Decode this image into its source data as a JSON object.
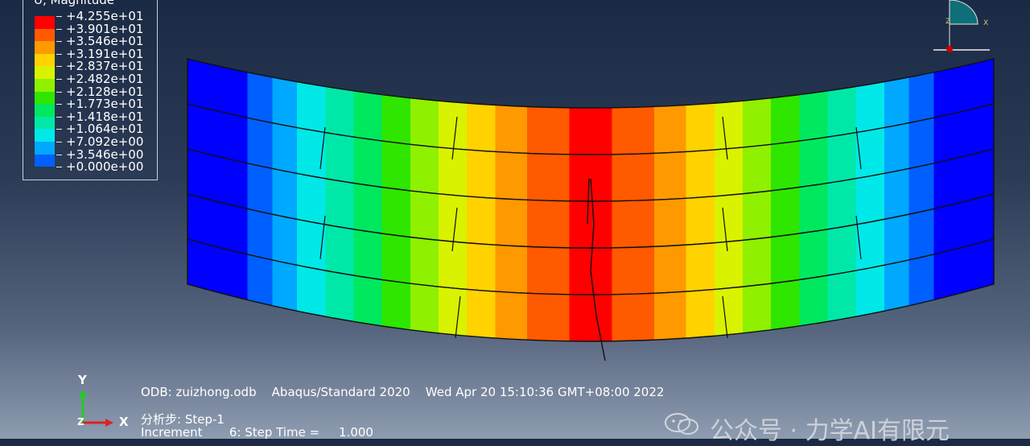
{
  "legend": {
    "title": "U, Magnitude",
    "labels": [
      "+4.255e+01",
      "+3.901e+01",
      "+3.546e+01",
      "+3.191e+01",
      "+2.837e+01",
      "+2.482e+01",
      "+2.128e+01",
      "+1.773e+01",
      "+1.418e+01",
      "+1.064e+01",
      "+7.092e+00",
      "+3.546e+00",
      "+0.000e+00"
    ],
    "colors": [
      "#ff0000",
      "#ff5a00",
      "#ff9900",
      "#ffd200",
      "#d9f200",
      "#8ff000",
      "#2ee600",
      "#00e85e",
      "#00e8a8",
      "#00e8e8",
      "#00a8ff",
      "#0060ff",
      "#0000ff"
    ]
  },
  "info": {
    "line1": "ODB: zuizhong.odb    Abaqus/Standard 2020    Wed Apr 20 15:10:36 GMT+08:00 2022",
    "line2": "分析步: Step-1",
    "line3": "Increment       6: Step Time =     1.000"
  },
  "triad": {
    "y_label": "Y",
    "x_label": "X",
    "z_label": "Z"
  },
  "view_triad": {
    "z_label": "Z",
    "x_label": "X"
  },
  "watermark": {
    "text": "公众号 · 力学AI有限元"
  },
  "model": {
    "layers": 5,
    "blocks_per_layer": 2
  },
  "colors": {
    "outline": "#101010",
    "bg_top": "#1b2a44",
    "bg_bottom": "#8e9cb1"
  }
}
